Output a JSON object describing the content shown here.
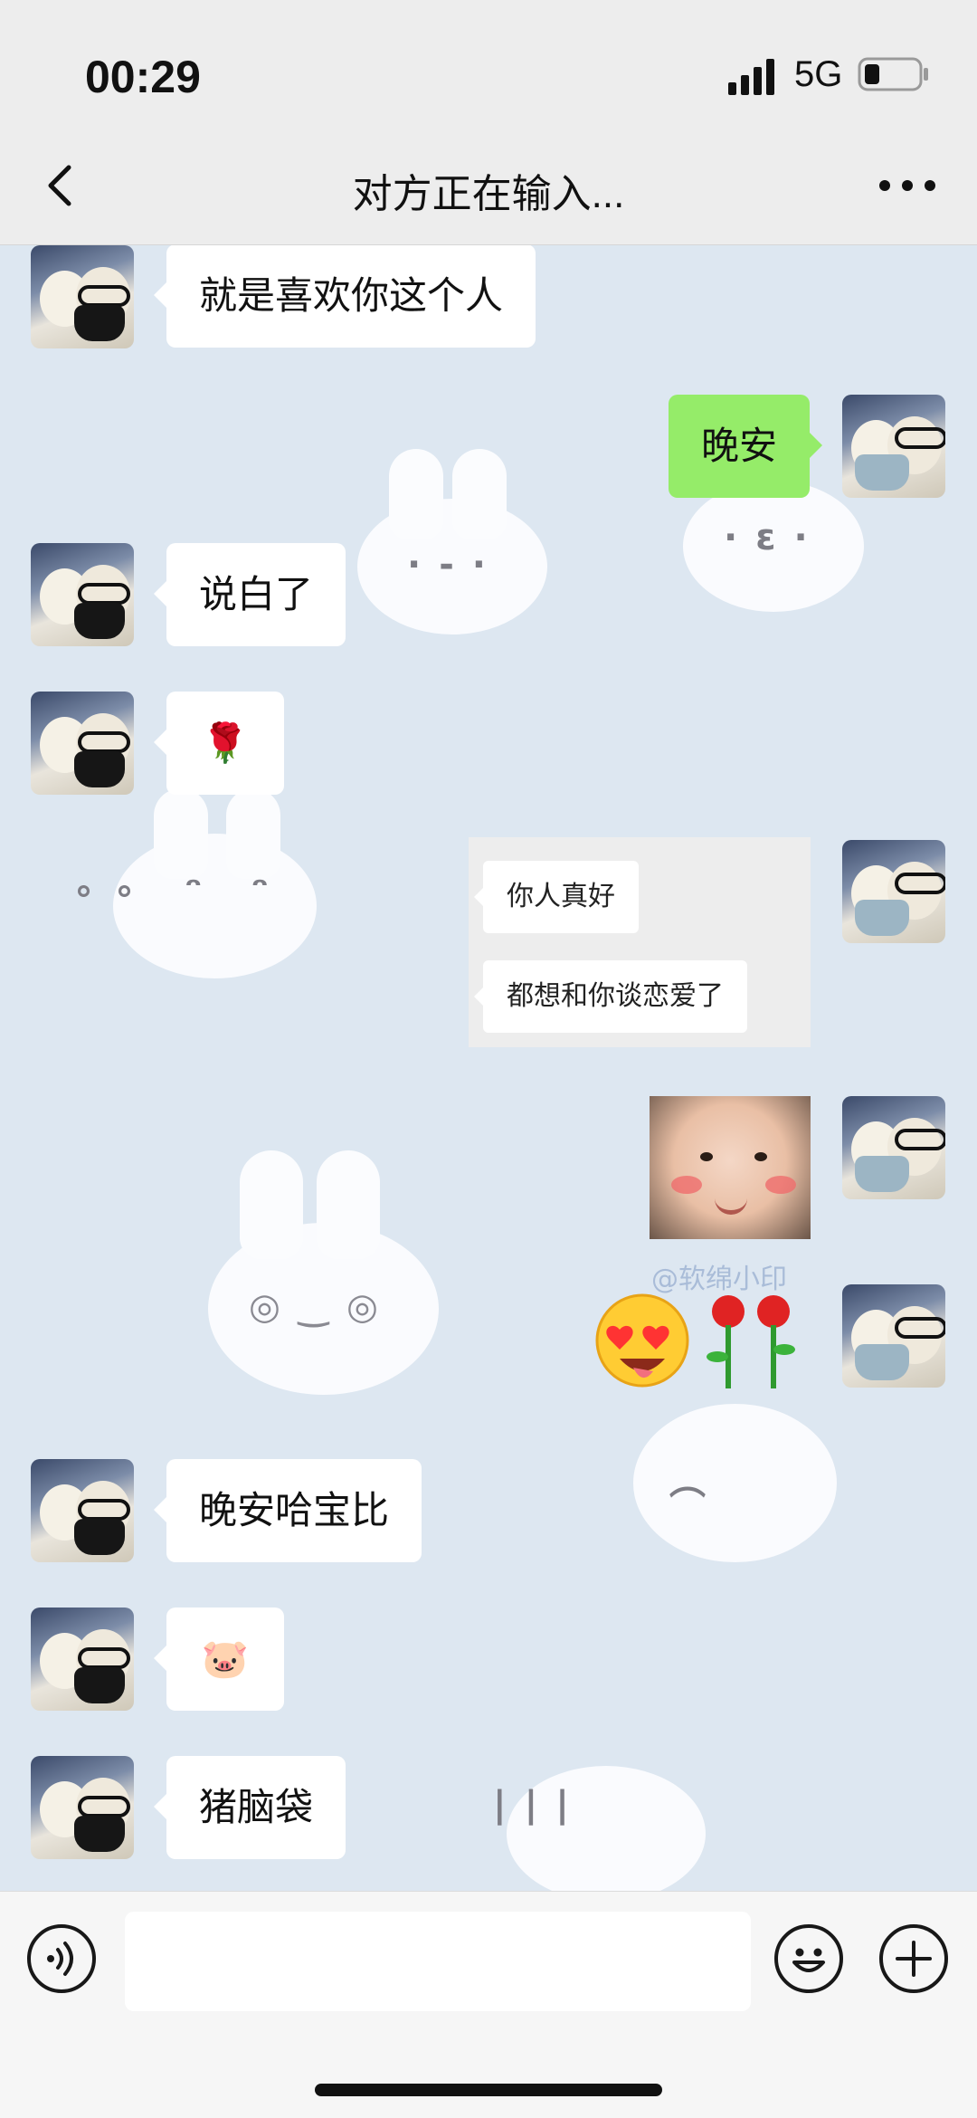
{
  "status_bar": {
    "time": "00:29",
    "network": "5G",
    "icons": [
      "signal-icon",
      "battery-icon"
    ]
  },
  "header": {
    "title": "对方正在输入...",
    "back_icon": "chevron-left-icon",
    "more_icon": "more-dots-icon"
  },
  "messages": [
    {
      "side": "left",
      "type": "text",
      "text": "就是喜欢你这个人"
    },
    {
      "side": "right",
      "type": "text",
      "text": "晚安"
    },
    {
      "side": "left",
      "type": "text",
      "text": "说白了"
    },
    {
      "side": "left",
      "type": "emoji",
      "text": "🌹"
    },
    {
      "side": "right",
      "type": "screenshot",
      "lines": [
        "你人真好",
        "都想和你谈恋爱了"
      ]
    },
    {
      "side": "right",
      "type": "image",
      "icon": "baby-face-sticker"
    },
    {
      "side": "right",
      "type": "sticker",
      "icon": "heart-eyes-roses-sticker"
    },
    {
      "side": "left",
      "type": "text",
      "text": "晚安哈宝比"
    },
    {
      "side": "left",
      "type": "emoji",
      "text": "🐷"
    },
    {
      "side": "left",
      "type": "text",
      "text": "猪脑袋"
    }
  ],
  "watermark": "@软绵小印",
  "input_bar": {
    "voice_icon": "voice-icon",
    "emoji_icon": "smiley-icon",
    "plus_icon": "plus-icon",
    "input_value": ""
  },
  "colors": {
    "sent_bubble": "#95ec69",
    "received_bubble": "#ffffff",
    "background": "#dde7f1"
  }
}
